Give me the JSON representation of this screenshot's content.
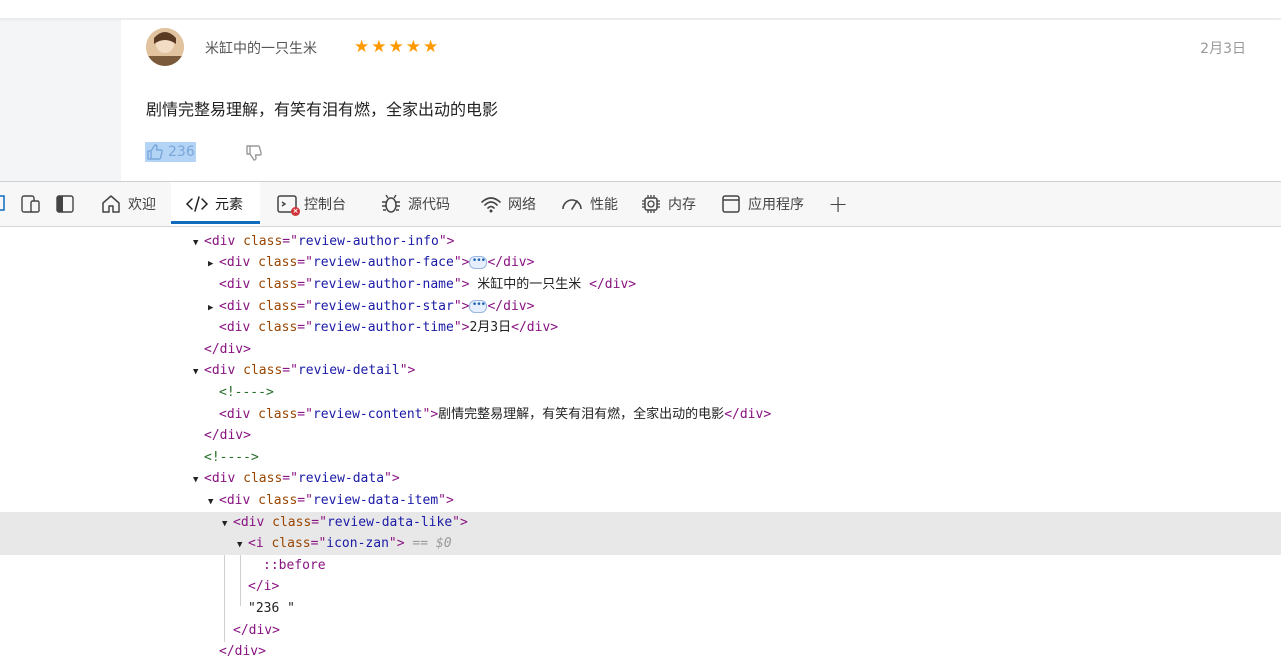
{
  "review": {
    "author_name": "米缸中的一只生米",
    "star_count": 5,
    "time": "2月3日",
    "content": "剧情完整易理解，有笑有泪有燃，全家出动的电影",
    "like_count": "236"
  },
  "devtools": {
    "tabs": [
      {
        "label": "欢迎",
        "icon": "home-icon"
      },
      {
        "label": "元素",
        "icon": "code-icon",
        "active": true
      },
      {
        "label": "控制台",
        "icon": "console-icon",
        "error_badge": true
      },
      {
        "label": "源代码",
        "icon": "bug-icon"
      },
      {
        "label": "网络",
        "icon": "wifi-icon"
      },
      {
        "label": "性能",
        "icon": "gauge-icon"
      },
      {
        "label": "内存",
        "icon": "chip-icon"
      },
      {
        "label": "应用程序",
        "icon": "app-window-icon"
      }
    ],
    "add_tab_label": "+"
  },
  "dom": {
    "author_info": "review-author-info",
    "author_face": "review-author-face",
    "author_name_class": "review-author-name",
    "author_name_text": " 米缸中的一只生米 ",
    "author_star": "review-author-star",
    "author_time": "review-author-time",
    "author_time_text": "2月3日",
    "detail": "review-detail",
    "comment": "<!---->",
    "content_class": "review-content",
    "content_text": "剧情完整易理解，有笑有泪有燃，全家出动的电影",
    "data": "review-data",
    "data_item": "review-data-item",
    "data_like": "review-data-like",
    "icon_class": "icon-zan",
    "selected_marker": "== $0",
    "pseudo": "::before",
    "like_text": "\"236 \""
  }
}
